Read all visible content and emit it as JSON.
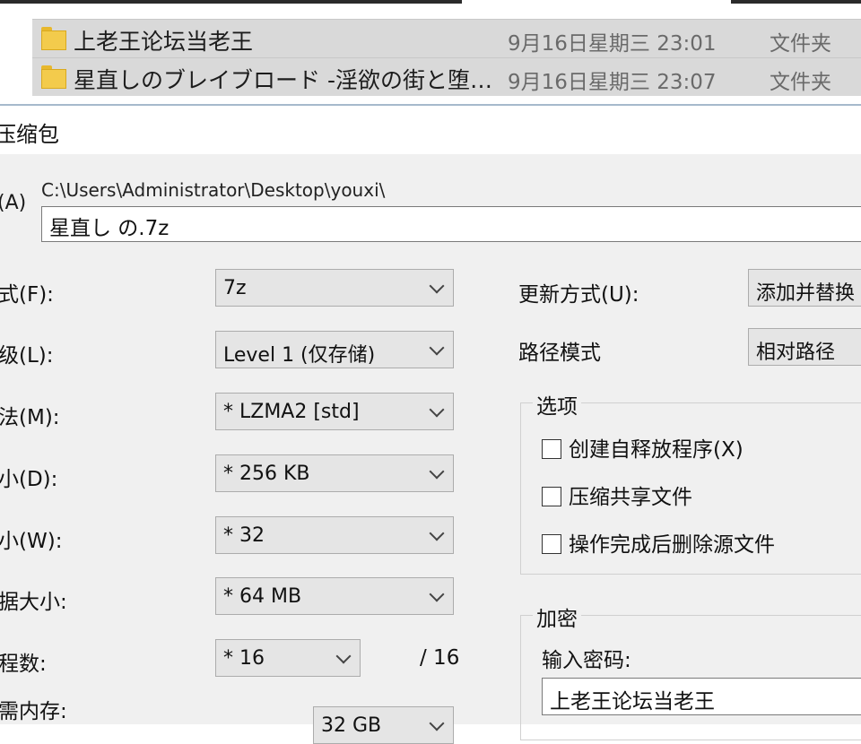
{
  "explorer": {
    "rows": [
      {
        "name": "上老王论坛当老王",
        "date": "9月16日星期三 23:01",
        "type": "文件夹"
      },
      {
        "name": "星直しのブレイブロード -淫欲の街と堕…",
        "date": "9月16日星期三 23:07",
        "type": "文件夹"
      }
    ]
  },
  "dialog": {
    "title": "压缩包",
    "archive_label": "(A)",
    "archive_path": "C:\\Users\\Administrator\\Desktop\\youxi\\",
    "archive_name": "星直し の.7z",
    "fields": {
      "format": {
        "label": "式(F):",
        "value": "7z"
      },
      "level": {
        "label": "级(L):",
        "value": "Level 1 (仅存储)"
      },
      "method": {
        "label": "法(M):",
        "value": "*  LZMA2 [std]"
      },
      "dict": {
        "label": "小(D):",
        "value": "*  256 KB"
      },
      "word": {
        "label": "小(W):",
        "value": "*  32"
      },
      "solid": {
        "label": "据大小:",
        "value": "*  64 MB"
      },
      "threads": {
        "label": "程数:",
        "value": "*  16",
        "max": "/ 16"
      },
      "memory": {
        "label": "需内存:",
        "value": "32 GB"
      }
    },
    "update_mode": {
      "label": "更新方式(U):",
      "value": "添加并替换"
    },
    "path_mode": {
      "label": "路径模式",
      "value": "相对路径"
    },
    "options": {
      "title": "选项",
      "sfx": "创建自释放程序(X)",
      "shared": "压缩共享文件",
      "delete_after": "操作完成后删除源文件"
    },
    "encryption": {
      "title": "加密",
      "password_label": "输入密码:",
      "password_value": "上老王论坛当老王"
    }
  }
}
